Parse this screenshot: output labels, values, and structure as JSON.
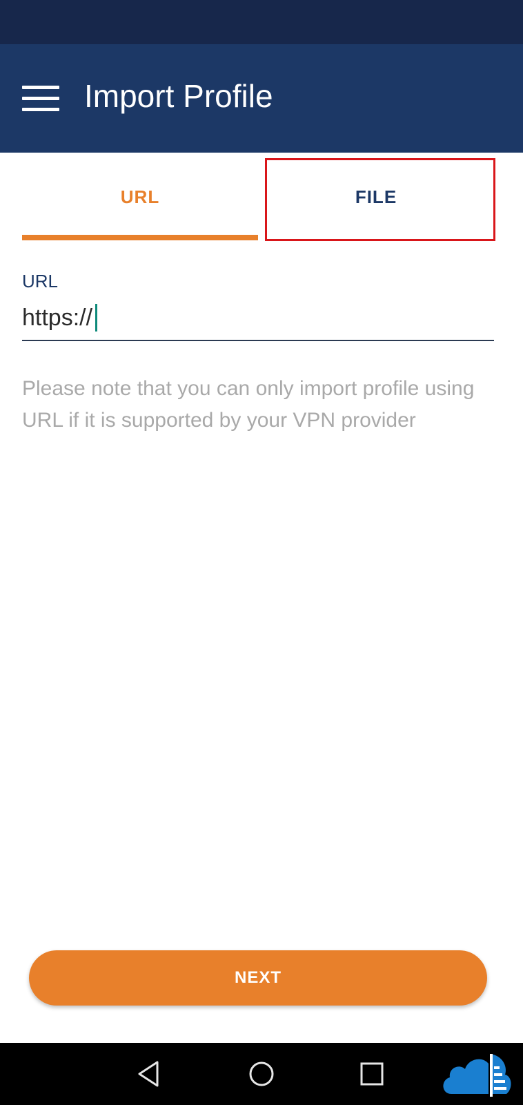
{
  "app_bar": {
    "title": "Import Profile",
    "menu_icon": "hamburger-menu-icon"
  },
  "tabs": [
    {
      "label": "URL",
      "selected": true
    },
    {
      "label": "FILE",
      "selected": false,
      "highlighted": true
    }
  ],
  "form": {
    "url_label": "URL",
    "url_value": "https://",
    "note": "Please note that you can only import profile using URL if it is supported by your VPN provider"
  },
  "next_button": {
    "label": "NEXT"
  },
  "nav_bar": {
    "icons": [
      "back-icon",
      "home-icon",
      "recent-apps-icon"
    ]
  },
  "colors": {
    "status_bar": "#17274b",
    "app_bar": "#1c3866",
    "accent": "#e8802b",
    "highlight": "#d9161a",
    "note_text": "#a9a9a9"
  }
}
